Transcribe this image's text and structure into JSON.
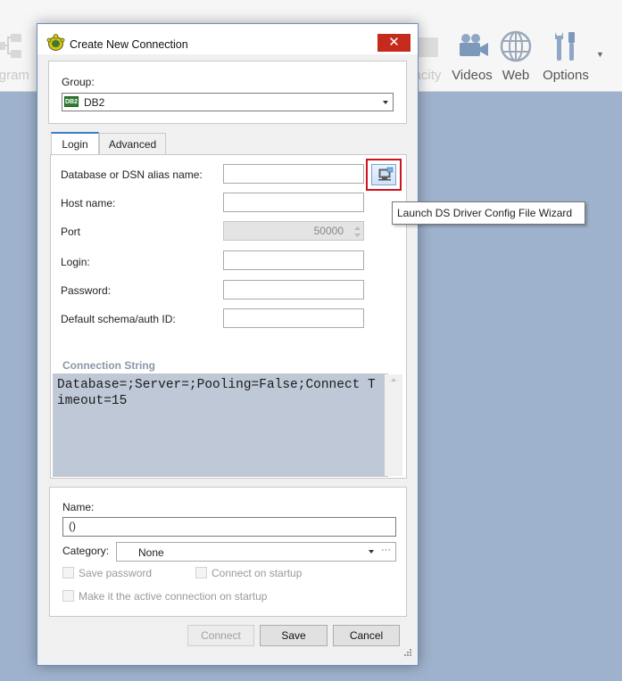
{
  "app_toolbar": {
    "items": [
      {
        "label": "iagram",
        "icon": "diagram-icon",
        "faded": true
      },
      {
        "label": "acity",
        "icon": "capacity-icon",
        "faded": true
      },
      {
        "label": "Videos",
        "icon": "video-camera-icon"
      },
      {
        "label": "Web",
        "icon": "globe-icon"
      },
      {
        "label": "Options",
        "icon": "tools-icon"
      }
    ]
  },
  "dialog": {
    "title": "Create New Connection",
    "close_glyph": "✕",
    "group": {
      "label": "Group:",
      "value": "DB2",
      "icon_text": "DB2"
    },
    "tabs": [
      {
        "label": "Login",
        "active": true
      },
      {
        "label": "Advanced",
        "active": false
      }
    ],
    "fields": {
      "database_label": "Database or DSN alias name:",
      "database_value": "",
      "host_label": "Host name:",
      "host_value": "",
      "port_label": "Port",
      "port_value": "50000",
      "login_label": "Login:",
      "login_value": "",
      "password_label": "Password:",
      "password_value": "",
      "schema_label": "Default schema/auth ID:",
      "schema_value": ""
    },
    "tooltip": "Launch DS Driver Config File Wizard",
    "connection_string": {
      "label": "Connection String",
      "value": "Database=;Server=;Pooling=False;Connect Timeout=15"
    },
    "name": {
      "label": "Name:",
      "value": "()"
    },
    "category": {
      "label": "Category:",
      "value": "None",
      "more": "···"
    },
    "checkboxes": {
      "save_password": "Save password",
      "connect_on_startup": "Connect on startup",
      "make_active": "Make it the active connection on startup"
    },
    "buttons": {
      "connect": "Connect",
      "save": "Save",
      "cancel": "Cancel"
    }
  },
  "colors": {
    "accent": "#3c7fc4",
    "highlight": "#d0121b",
    "close": "#c42b1c",
    "background": "#9fb2cd"
  }
}
